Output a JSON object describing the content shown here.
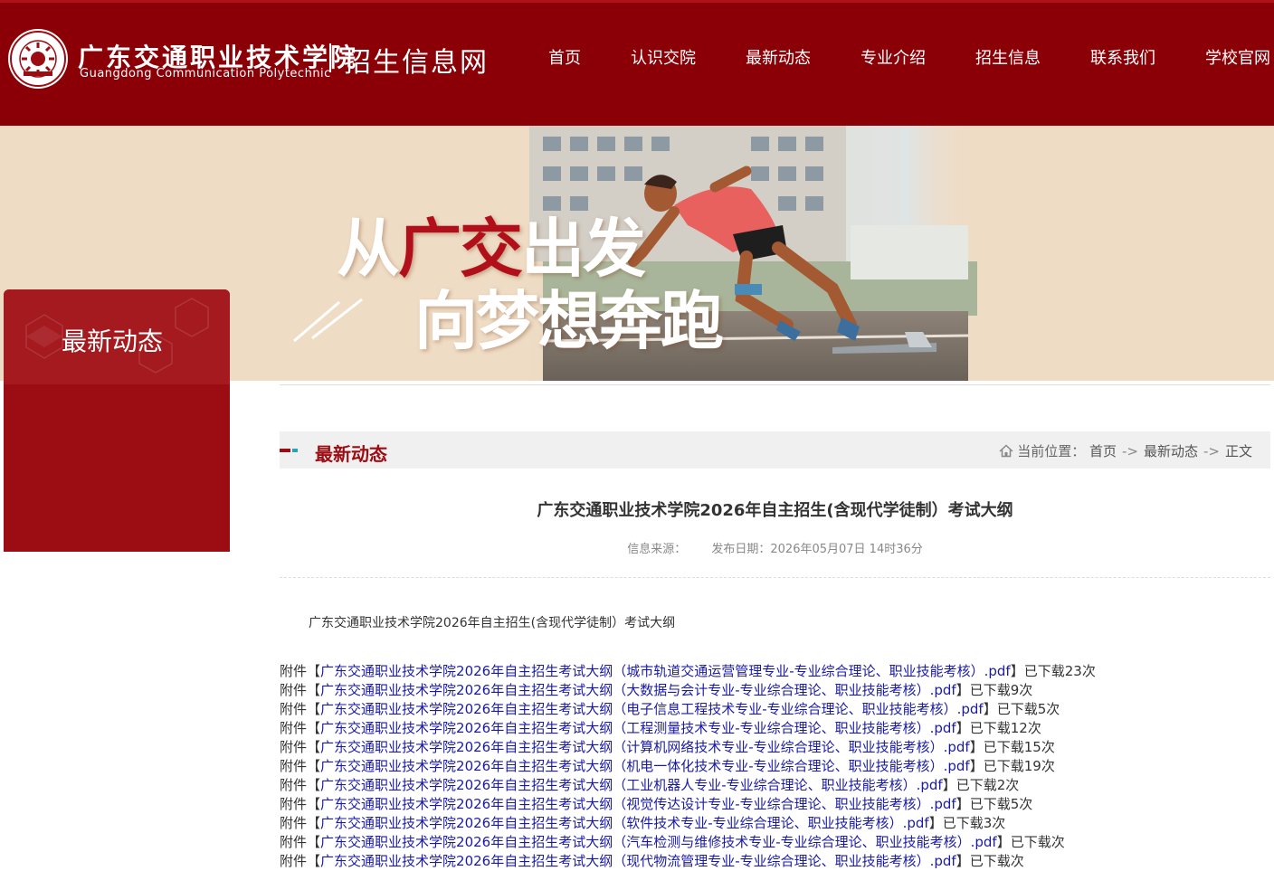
{
  "header": {
    "brand_cn": "广东交通职业技术学院",
    "brand_en": "Guangdong Communication Polytechnic",
    "site_name": "招生信息网",
    "nav": [
      {
        "label": "首页"
      },
      {
        "label": "认识交院"
      },
      {
        "label": "最新动态"
      },
      {
        "label": "专业介绍"
      },
      {
        "label": "招生信息"
      },
      {
        "label": "联系我们"
      },
      {
        "label": "学校官网"
      }
    ],
    "colors": {
      "bar": "#8a0006",
      "accent": "#b1101a"
    }
  },
  "banner": {
    "slogan1_a": "从",
    "slogan1_b": "广交",
    "slogan1_c": "出发",
    "slogan2": "向梦想奔跑"
  },
  "sidebar": {
    "title": "最新动态"
  },
  "column": {
    "title": "最新动态",
    "location_label": "当前位置：",
    "breadcrumb": [
      {
        "label": "首页"
      },
      {
        "label": "最新动态"
      },
      {
        "label": "正文"
      }
    ],
    "separator": "->"
  },
  "article": {
    "title": "广东交通职业技术学院2026年自主招生(含现代学徒制）考试大纲",
    "source_label": "信息来源：",
    "date_label": "发布日期：2026年05月07日 14时36分",
    "body": "广东交通职业技术学院2026年自主招生(含现代学徒制）考试大纲",
    "attachment_prefix": "附件",
    "attachments": [
      {
        "name": "广东交通职业技术学院2026年自主招生考试大纲（城市轨道交通运营管理专业-专业综合理论、职业技能考核）.pdf",
        "downloads": "已下载23次"
      },
      {
        "name": "广东交通职业技术学院2026年自主招生考试大纲（大数据与会计专业-专业综合理论、职业技能考核）.pdf",
        "downloads": "已下载9次"
      },
      {
        "name": "广东交通职业技术学院2026年自主招生考试大纲（电子信息工程技术专业-专业综合理论、职业技能考核）.pdf",
        "downloads": "已下载5次"
      },
      {
        "name": "广东交通职业技术学院2026年自主招生考试大纲（工程测量技术专业-专业综合理论、职业技能考核）.pdf",
        "downloads": "已下载12次"
      },
      {
        "name": "广东交通职业技术学院2026年自主招生考试大纲（计算机网络技术专业-专业综合理论、职业技能考核）.pdf",
        "downloads": "已下载15次"
      },
      {
        "name": "广东交通职业技术学院2026年自主招生考试大纲（机电一体化技术专业-专业综合理论、职业技能考核）.pdf",
        "downloads": "已下载19次"
      },
      {
        "name": "广东交通职业技术学院2026年自主招生考试大纲（工业机器人专业-专业综合理论、职业技能考核）.pdf",
        "downloads": "已下载2次"
      },
      {
        "name": "广东交通职业技术学院2026年自主招生考试大纲（视觉传达设计专业-专业综合理论、职业技能考核）.pdf",
        "downloads": "已下载5次"
      },
      {
        "name": "广东交通职业技术学院2026年自主招生考试大纲（软件技术专业-专业综合理论、职业技能考核）.pdf",
        "downloads": "已下载3次"
      },
      {
        "name": "广东交通职业技术学院2026年自主招生考试大纲（汽车检测与维修技术专业-专业综合理论、职业技能考核）.pdf",
        "downloads": "已下载次"
      },
      {
        "name": "广东交通职业技术学院2026年自主招生考试大纲（现代物流管理专业-专业综合理论、职业技能考核）.pdf",
        "downloads": "已下载次"
      }
    ]
  }
}
